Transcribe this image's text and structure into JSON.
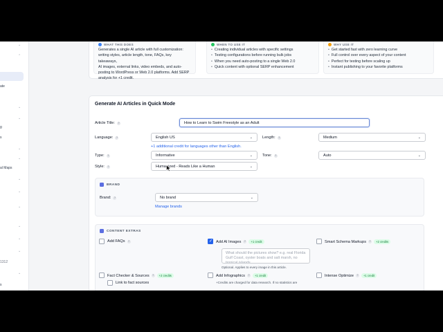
{
  "sidebar": {
    "fragments": [
      "ate",
      "g",
      "s",
      "al Maps",
      "1312",
      "s"
    ]
  },
  "info": {
    "columns": [
      {
        "heading": "WHAT THIS DOES",
        "dot_color": "#3b82f6",
        "lines": [
          "Generates a single AI article with full customization:",
          "writing styles, article length, tone, FAQs, key takeaways,",
          "AI images, external links, video embeds, and auto-",
          "posting to WordPress or Web 2.0 platforms. Add SERP",
          "analysis for +1 credit."
        ]
      },
      {
        "heading": "WHEN TO USE IT",
        "dot_color": "#22c55e",
        "bullets": [
          "Creating individual articles with specific settings",
          "Testing configurations before running bulk jobs",
          "When you need auto-posting to a single Web 2.0",
          "Quick content with optional SERP enhancement"
        ]
      },
      {
        "heading": "WHY USE IT",
        "dot_color": "#f59e0b",
        "bullets": [
          "Get started fast with zero learning curve",
          "Full control over every aspect of your content",
          "Perfect for testing before scaling up",
          "Instant publishing to your favorite platforms"
        ]
      }
    ]
  },
  "form": {
    "title": "Generate AI Articles in Quick Mode",
    "article_title_label": "Article Title:",
    "article_title_value": "How to Learn to Swim Freestyle as an Adult",
    "language_label": "Language:",
    "language_value": "English US",
    "language_note": "+1 additional credit for languages other than English.",
    "length_label": "Length:",
    "length_value": "Medium",
    "type_label": "Type:",
    "type_value": "Informative",
    "tone_label": "Tone:",
    "tone_value": "Auto",
    "style_label": "Style:",
    "style_value": "Humanized - Reads Like a Human"
  },
  "brand": {
    "heading": "BRAND",
    "label": "Brand:",
    "value": "No brand",
    "manage_link": "Manage brands"
  },
  "extras": {
    "heading": "CONTENT EXTRAS",
    "add_faqs": "Add FAQs",
    "add_ai_images": "Add AI Images",
    "add_ai_images_credit": "+1 credit",
    "ai_images_placeholder": "What should the pictures show? e.g. real Florida Gulf Coast, oyster boats and salt marsh, no tropical islands",
    "ai_images_hint": "Optional. Applies to every image in this article.",
    "smart_schema": "Smart Schema Markups",
    "smart_schema_credit": "+2 credits",
    "fact_checker": "Fact Checker & Sources",
    "fact_checker_credit": "+2 credits",
    "link_to_fact": "Link to fact sources",
    "add_infographics": "Add Infographics",
    "add_infographics_credit": "+1 credit",
    "infographics_hint": "+Credits are charged for data research. If no statistics are",
    "intense_optimize": "Intense Optimize",
    "intense_optimize_credit": "+1 credit"
  }
}
